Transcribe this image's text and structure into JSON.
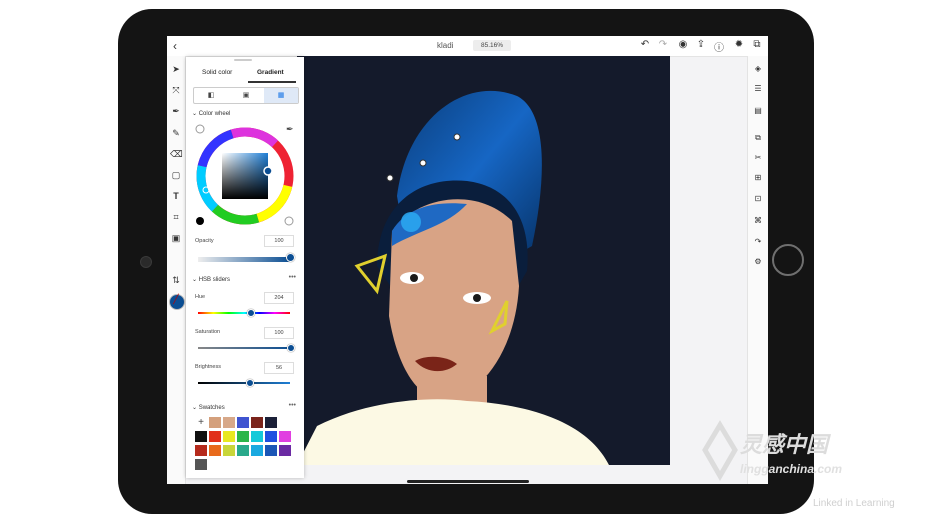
{
  "app": {
    "doc_title": "kladi",
    "zoom_level": "85.16%"
  },
  "topbar_icons": [
    "back-arrow-icon",
    "undo-icon",
    "redo-icon",
    "profile-icon",
    "share-icon",
    "help-icon",
    "settings-icon",
    "crop-icon"
  ],
  "left_tools": [
    "select-icon",
    "direct-select-icon",
    "pen-icon",
    "pencil-icon",
    "eraser-icon",
    "shape-icon",
    "text-icon",
    "transform-icon",
    "image-icon"
  ],
  "right_tools": [
    "layers-icon",
    "properties-icon",
    "align-icon",
    "combine-icon",
    "cut-icon",
    "distribute-icon",
    "repeat-icon",
    "pattern-icon",
    "redo-arc-icon",
    "gear-icon"
  ],
  "color_panel": {
    "tab_solid": "Solid color",
    "tab_gradient": "Gradient",
    "color_wheel_label": "Color wheel",
    "opacity_label": "Opacity",
    "opacity_value": "100",
    "hsb_label": "HSB sliders",
    "hue_label": "Hue",
    "hue_value": "204",
    "saturation_label": "Saturation",
    "saturation_value": "100",
    "brightness_label": "Brightness",
    "brightness_value": "56",
    "swatches_label": "Swatches",
    "current_color": "#0b4e93"
  },
  "swatch_colors": [
    "#d4a07c",
    "#d7a889",
    "#3f54d0",
    "#7a241b",
    "#1b2038",
    "#111111",
    "#e1301b",
    "#e8e820",
    "#2ab54a",
    "#14c9d9",
    "#1f4fe0",
    "#e13fe1",
    "#b52a1c",
    "#e86a1c",
    "#c8d63a",
    "#29a98b",
    "#1aa9e0",
    "#1b56b6",
    "#6b2aa3",
    "#555555"
  ],
  "watermark": {
    "title": "灵感中国",
    "site": "lingganchina.com",
    "source": "Linked in Learning"
  }
}
